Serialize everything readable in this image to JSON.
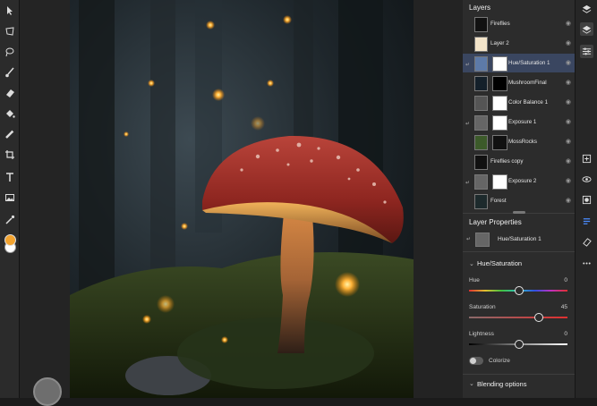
{
  "tools": {
    "items": [
      "select-icon",
      "lasso-icon",
      "quick-select-icon",
      "brush-icon",
      "eraser-icon",
      "fill-icon",
      "healing-icon",
      "crop-icon",
      "text-icon",
      "image-icon",
      "eyedropper-icon"
    ]
  },
  "colors": {
    "foreground": "#f2a32f",
    "background": "#ffffff",
    "accent": "#3a6ed6"
  },
  "layers": {
    "title": "Layers",
    "items": [
      {
        "name": "Fireflies"
      },
      {
        "name": "Layer 2"
      },
      {
        "name": "Hue/Saturation 1"
      },
      {
        "name": "MushroomFinal"
      },
      {
        "name": "Color Balance 1"
      },
      {
        "name": "Exposure 1"
      },
      {
        "name": "MossRocks"
      },
      {
        "name": "Fireflies copy"
      },
      {
        "name": "Exposure 2"
      },
      {
        "name": "Forest"
      }
    ]
  },
  "properties": {
    "title": "Layer Properties",
    "layer_name": "Hue/Saturation 1",
    "section": "Hue/Saturation",
    "hue": {
      "label": "Hue",
      "value": "0"
    },
    "saturation": {
      "label": "Saturation",
      "value": "45"
    },
    "lightness": {
      "label": "Lightness",
      "value": "0"
    },
    "colorize": "Colorize",
    "blending": "Blending options"
  }
}
